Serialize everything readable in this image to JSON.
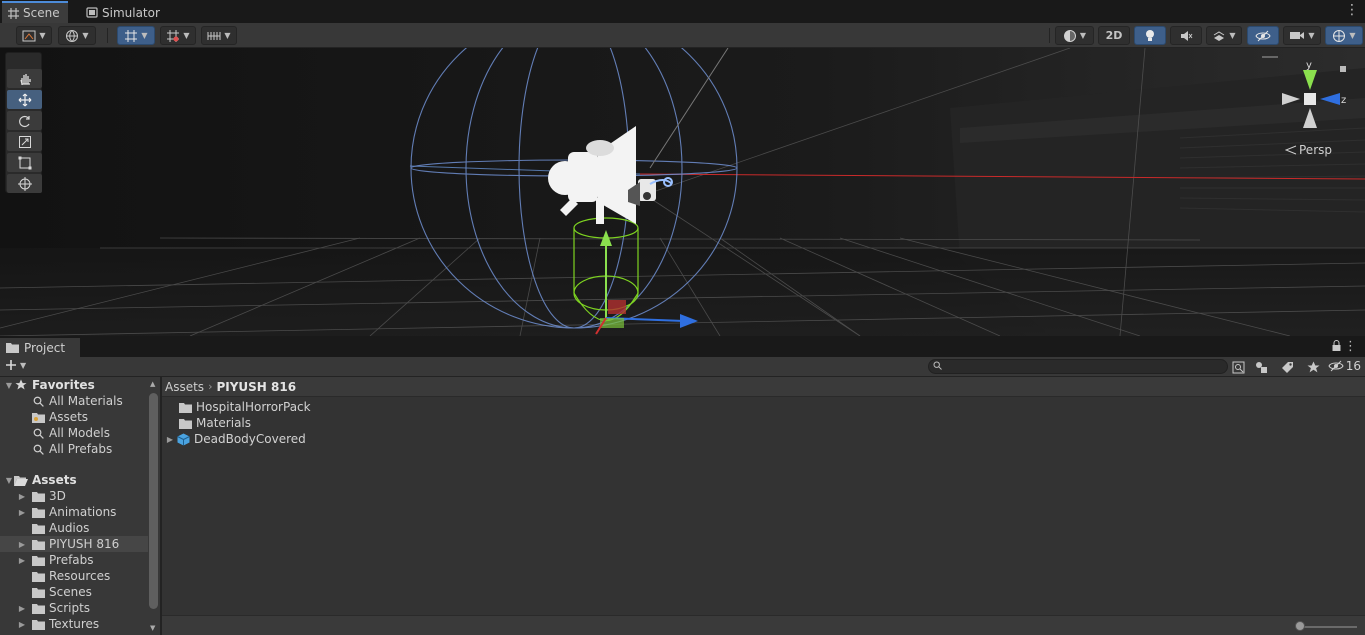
{
  "scene_tabs": [
    {
      "label": "Scene",
      "icon": "grid-icon",
      "active": true
    },
    {
      "label": "Simulator",
      "icon": "device-icon",
      "active": false
    }
  ],
  "scene_toolbar": {
    "two_d_label": "2D"
  },
  "viewport": {
    "gizmo_axes": {
      "y": "y",
      "z": "z"
    },
    "projection_label": "Persp"
  },
  "project": {
    "tab_label": "Project",
    "search_placeholder": "",
    "hidden_count": "16",
    "favorites": {
      "header": "Favorites",
      "items": [
        "All Materials",
        "Assets",
        "All Models",
        "All Prefabs"
      ]
    },
    "assets_tree": {
      "header": "Assets",
      "items": [
        {
          "label": "3D",
          "expandable": true,
          "selected": false
        },
        {
          "label": "Animations",
          "expandable": true,
          "selected": false
        },
        {
          "label": "Audios",
          "expandable": false,
          "selected": false
        },
        {
          "label": "PIYUSH 816",
          "expandable": true,
          "selected": true
        },
        {
          "label": "Prefabs",
          "expandable": true,
          "selected": false
        },
        {
          "label": "Resources",
          "expandable": false,
          "selected": false
        },
        {
          "label": "Scenes",
          "expandable": false,
          "selected": false
        },
        {
          "label": "Scripts",
          "expandable": true,
          "selected": false
        },
        {
          "label": "Textures",
          "expandable": true,
          "selected": false
        }
      ]
    },
    "breadcrumb": [
      "Assets",
      "PIYUSH 816"
    ],
    "contents": [
      {
        "label": "HospitalHorrorPack",
        "type": "folder"
      },
      {
        "label": "Materials",
        "type": "folder"
      },
      {
        "label": "DeadBodyCovered",
        "type": "prefab"
      }
    ]
  },
  "colors": {
    "accent_blue": "#3e5f8a",
    "selection": "#464646",
    "panel": "#383838"
  }
}
